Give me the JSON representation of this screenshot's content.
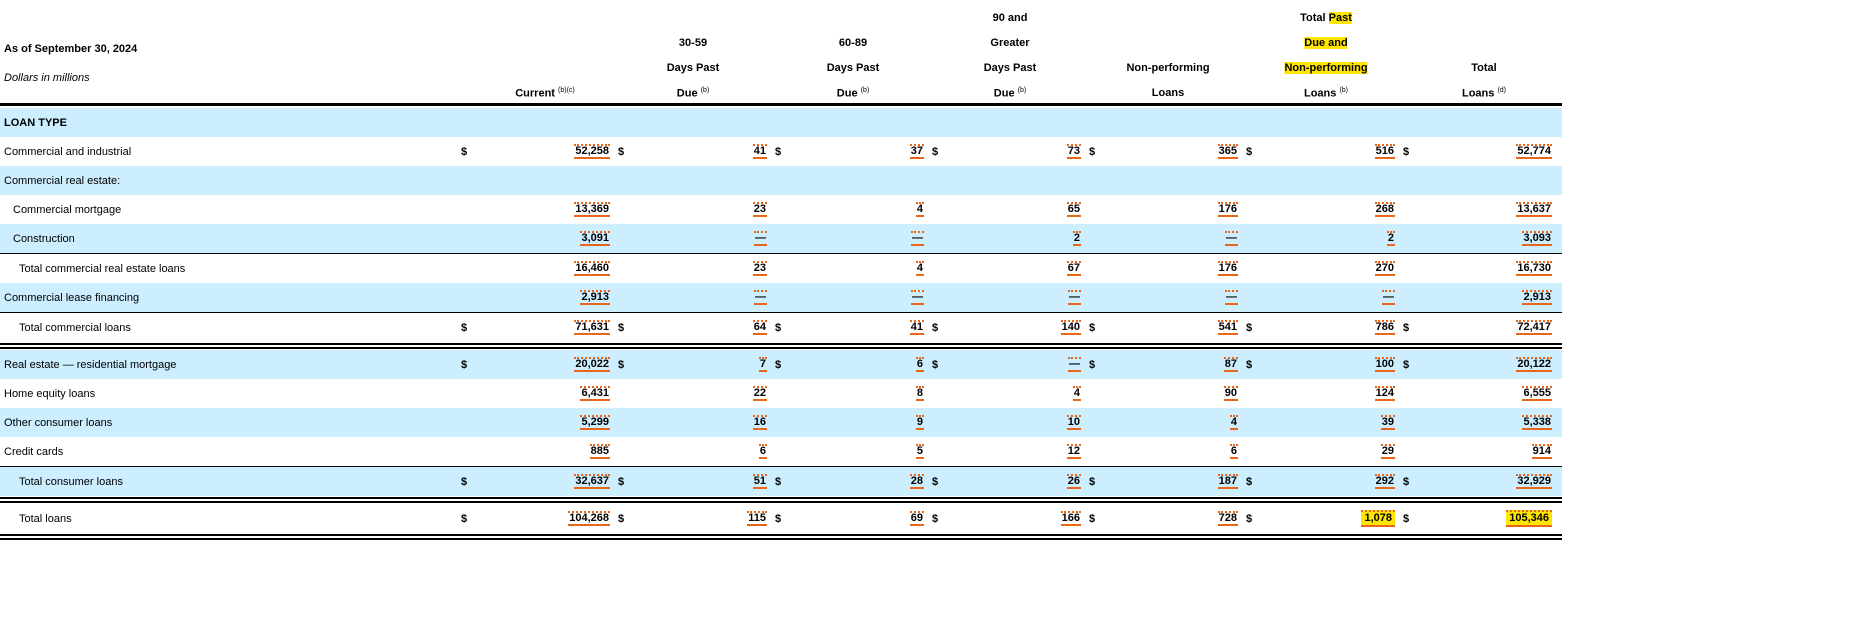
{
  "header": {
    "as_of": "As of September 30, 2024",
    "units": "Dollars in millions"
  },
  "columns": [
    {
      "lines": [
        "Current"
      ],
      "sup": "(b)(c)"
    },
    {
      "lines": [
        "30-59",
        "Days Past",
        "Due"
      ],
      "sup": "(b)"
    },
    {
      "lines": [
        "60-89",
        "Days Past",
        "Due"
      ],
      "sup": "(b)"
    },
    {
      "lines": [
        "90 and",
        "Greater",
        "Days Past",
        "Due"
      ],
      "sup": "(b)"
    },
    {
      "lines": [
        "Non-performing",
        "Loans"
      ],
      "sup": ""
    },
    {
      "lines": [
        "Total Past",
        "Due and",
        "Non-performing",
        "Loans"
      ],
      "sup": "(b)"
    },
    {
      "lines": [
        "Total",
        "Loans"
      ],
      "sup": "(d)"
    }
  ],
  "highlight_color": "#ffe600",
  "rows": [
    {
      "label": "LOAN TYPE",
      "style": "section",
      "values": []
    },
    {
      "label": "Commercial and industrial",
      "dollar": true,
      "values": [
        "52,258",
        "41",
        "37",
        "73",
        "365",
        "516",
        "52,774"
      ]
    },
    {
      "label": "Commercial real estate:",
      "values": []
    },
    {
      "label": "Commercial mortgage",
      "indent": 1,
      "values": [
        "13,369",
        "23",
        "4",
        "65",
        "176",
        "268",
        "13,637"
      ]
    },
    {
      "label": "Construction",
      "indent": 1,
      "values": [
        "3,091",
        "—",
        "—",
        "2",
        "—",
        "2",
        "3,093"
      ],
      "after": "line"
    },
    {
      "label": "Total commercial real estate loans",
      "indent": 2,
      "values": [
        "16,460",
        "23",
        "4",
        "67",
        "176",
        "270",
        "16,730"
      ]
    },
    {
      "label": "Commercial lease financing",
      "values": [
        "2,913",
        "—",
        "—",
        "—",
        "—",
        "—",
        "2,913"
      ],
      "after": "line"
    },
    {
      "label": "Total commercial loans",
      "indent": 2,
      "dollar": true,
      "values": [
        "71,631",
        "64",
        "41",
        "140",
        "541",
        "786",
        "72,417"
      ],
      "after": "dbl"
    },
    {
      "label": "Real estate — residential mortgage",
      "dollar": true,
      "values": [
        "20,022",
        "7",
        "6",
        "—",
        "87",
        "100",
        "20,122"
      ]
    },
    {
      "label": "Home equity loans",
      "values": [
        "6,431",
        "22",
        "8",
        "4",
        "90",
        "124",
        "6,555"
      ]
    },
    {
      "label": "Other consumer loans",
      "values": [
        "5,299",
        "16",
        "9",
        "10",
        "4",
        "39",
        "5,338"
      ]
    },
    {
      "label": "Credit cards",
      "values": [
        "885",
        "6",
        "5",
        "12",
        "6",
        "29",
        "914"
      ],
      "after": "line"
    },
    {
      "label": "Total consumer loans",
      "indent": 2,
      "dollar": true,
      "values": [
        "32,637",
        "51",
        "28",
        "26",
        "187",
        "292",
        "32,929"
      ],
      "after": "dbl"
    },
    {
      "label": "Total loans",
      "indent": 2,
      "dollar": true,
      "values": [
        "104,268",
        "115",
        "69",
        "166",
        "728",
        "1,078",
        "105,346"
      ],
      "highlight": [
        5,
        6
      ],
      "after": "dbl"
    }
  ]
}
